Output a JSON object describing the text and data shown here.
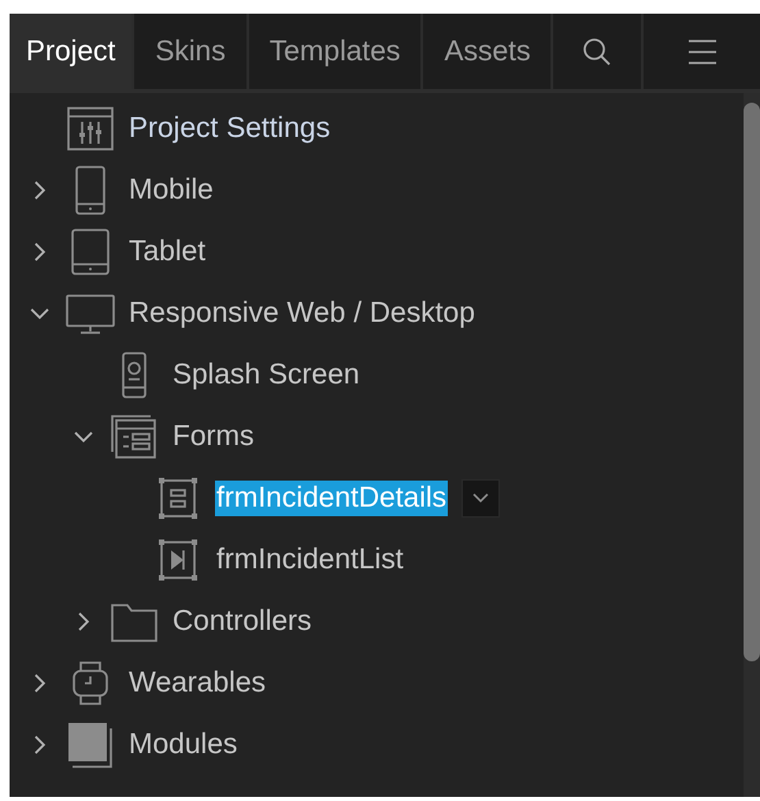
{
  "tabs": [
    {
      "label": "Project",
      "selected": true
    },
    {
      "label": "Skins",
      "selected": false
    },
    {
      "label": "Templates",
      "selected": false
    },
    {
      "label": "Assets",
      "selected": false
    }
  ],
  "toolbar": [
    {
      "kind": "search"
    },
    {
      "kind": "menu"
    }
  ],
  "tree": [
    {
      "label": "Project Settings",
      "kind": "settings",
      "selected": false
    },
    {
      "label": "Mobile",
      "kind": "mobile",
      "expanded": false,
      "selected": false
    },
    {
      "label": "Tablet",
      "kind": "tablet",
      "expanded": false,
      "selected": false
    },
    {
      "label": "Responsive Web / Desktop",
      "kind": "desktop",
      "expanded": true,
      "selected": false,
      "children": [
        {
          "label": "Splash Screen",
          "kind": "splash",
          "selected": false
        },
        {
          "label": "Forms",
          "kind": "forms",
          "expanded": true,
          "selected": false,
          "children": [
            {
              "label": "frmIncidentDetails",
              "kind": "form",
              "selected": true
            },
            {
              "label": "frmIncidentList",
              "kind": "form-list",
              "selected": false
            }
          ]
        },
        {
          "label": "Controllers",
          "kind": "folder",
          "expanded": false,
          "selected": false
        }
      ]
    },
    {
      "label": "Wearables",
      "kind": "watch",
      "expanded": false,
      "selected": false
    },
    {
      "label": "Modules",
      "kind": "modules",
      "expanded": false,
      "selected": false
    }
  ]
}
